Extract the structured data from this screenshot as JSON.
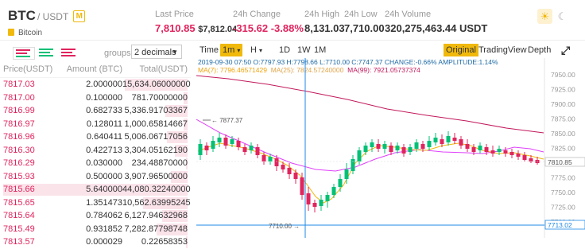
{
  "header": {
    "base": "BTC",
    "quote": "/ USDT",
    "badge": "M",
    "name": "Bitcoin",
    "last_price_label": "Last Price",
    "last_price": "7,810.85",
    "last_price_usd": "$7,812.04",
    "change_label": "24h Change",
    "change_value": "-315.62",
    "change_pct": "-3.88%",
    "high_label": "24h High",
    "high_value": "8,131.03",
    "low_label": "24h Low",
    "low_value": "7,710.00",
    "volume_label": "24h Volume",
    "volume_value": "320,275,463.44 USDT"
  },
  "orderbook": {
    "groups_label": "groups",
    "groups_value": "2 decimals",
    "col_price": "Price(USDT)",
    "col_amount": "Amount (BTC)",
    "col_total": "Total(USDT)",
    "rows": [
      {
        "price": "7817.03",
        "amount": "2.000000",
        "total": "15,634.06000000",
        "depth": 0.34
      },
      {
        "price": "7817.00",
        "amount": "0.100000",
        "total": "781.70000000",
        "depth": 0.02
      },
      {
        "price": "7816.99",
        "amount": "0.682733",
        "total": "5,336.91703367",
        "depth": 0.12
      },
      {
        "price": "7816.97",
        "amount": "0.128011",
        "total": "1,000.65814667",
        "depth": 0.02
      },
      {
        "price": "7816.96",
        "amount": "0.640411",
        "total": "5,006.06717056",
        "depth": 0.11
      },
      {
        "price": "7816.30",
        "amount": "0.422713",
        "total": "3,304.05162190",
        "depth": 0.07
      },
      {
        "price": "7816.29",
        "amount": "0.030000",
        "total": "234.48870000",
        "depth": 0.01
      },
      {
        "price": "7815.93",
        "amount": "0.500000",
        "total": "3,907.96500000",
        "depth": 0.09
      },
      {
        "price": "7815.66",
        "amount": "5.640000",
        "total": "44,080.32240000",
        "depth": 1.0
      },
      {
        "price": "7815.65",
        "amount": "1.351473",
        "total": "10,562.63995245",
        "depth": 0.24
      },
      {
        "price": "7815.64",
        "amount": "0.784062",
        "total": "6,127.94632968",
        "depth": 0.14
      },
      {
        "price": "7815.49",
        "amount": "0.931852",
        "total": "7,282.87798748",
        "depth": 0.17
      },
      {
        "price": "7813.57",
        "amount": "0.000029",
        "total": "0.22658353",
        "depth": 0.01
      }
    ]
  },
  "chart": {
    "toolbar": {
      "time": "Time",
      "interval": "1m",
      "caret": "▾",
      "h": "H",
      "d1": "1D",
      "w1": "1W",
      "m1": "1M",
      "original": "Original",
      "tradingview": "TradingView",
      "depth": "Depth",
      "expand": "⤢"
    },
    "info_line": "2019-09-30 07:50   O:7797.93 H:7798.66 L:7710.00 C:7747.37 CHANGE:-0.66% AMPLITUDE:1.14%",
    "ma7": "MA(7): 7796.46571429",
    "ma25": "MA(25): 7824.57240000",
    "ma99": "MA(99): 7921.05737374",
    "y_ticks": [
      "7950.00",
      "7925.00",
      "7900.00",
      "7875.00",
      "7850.00",
      "7825.00",
      "7800.00",
      "7775.00",
      "7750.00",
      "7725.00",
      "7700.00"
    ],
    "high_marker": "7877.37",
    "low_marker": "7710.00",
    "last_tag": "7810.85",
    "cross_tag": "7713.02"
  },
  "colors": {
    "up": "#02c076",
    "down": "#e0245e",
    "accent": "#f0b90b",
    "ma7": "#f0b90b",
    "ma25": "#e040fb",
    "ma99": "#c2185b",
    "crosshair": "#1e88e5"
  }
}
